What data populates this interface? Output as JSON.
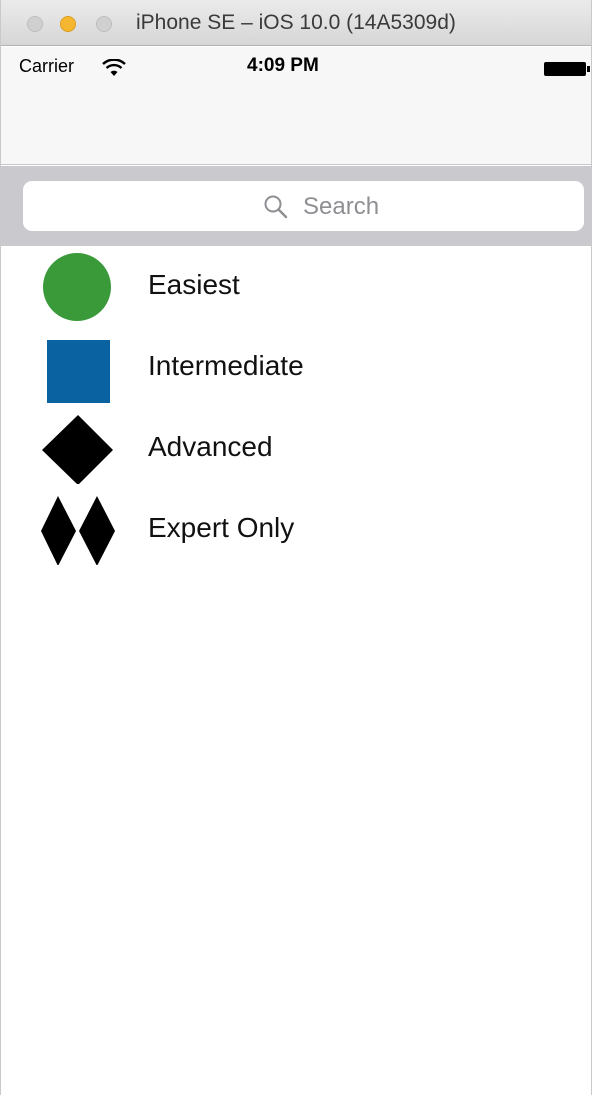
{
  "window": {
    "title": "iPhone SE – iOS 10.0 (14A5309d)"
  },
  "status_bar": {
    "carrier": "Carrier",
    "time": "4:09 PM"
  },
  "search": {
    "placeholder": "Search"
  },
  "list": {
    "items": [
      {
        "label": "Easiest",
        "icon": "green-circle-icon",
        "color": "#3a9a3a"
      },
      {
        "label": "Intermediate",
        "icon": "blue-square-icon",
        "color": "#0b62a0"
      },
      {
        "label": "Advanced",
        "icon": "black-diamond-icon",
        "color": "#000000"
      },
      {
        "label": "Expert Only",
        "icon": "double-black-diamond-icon",
        "color": "#000000"
      }
    ]
  }
}
